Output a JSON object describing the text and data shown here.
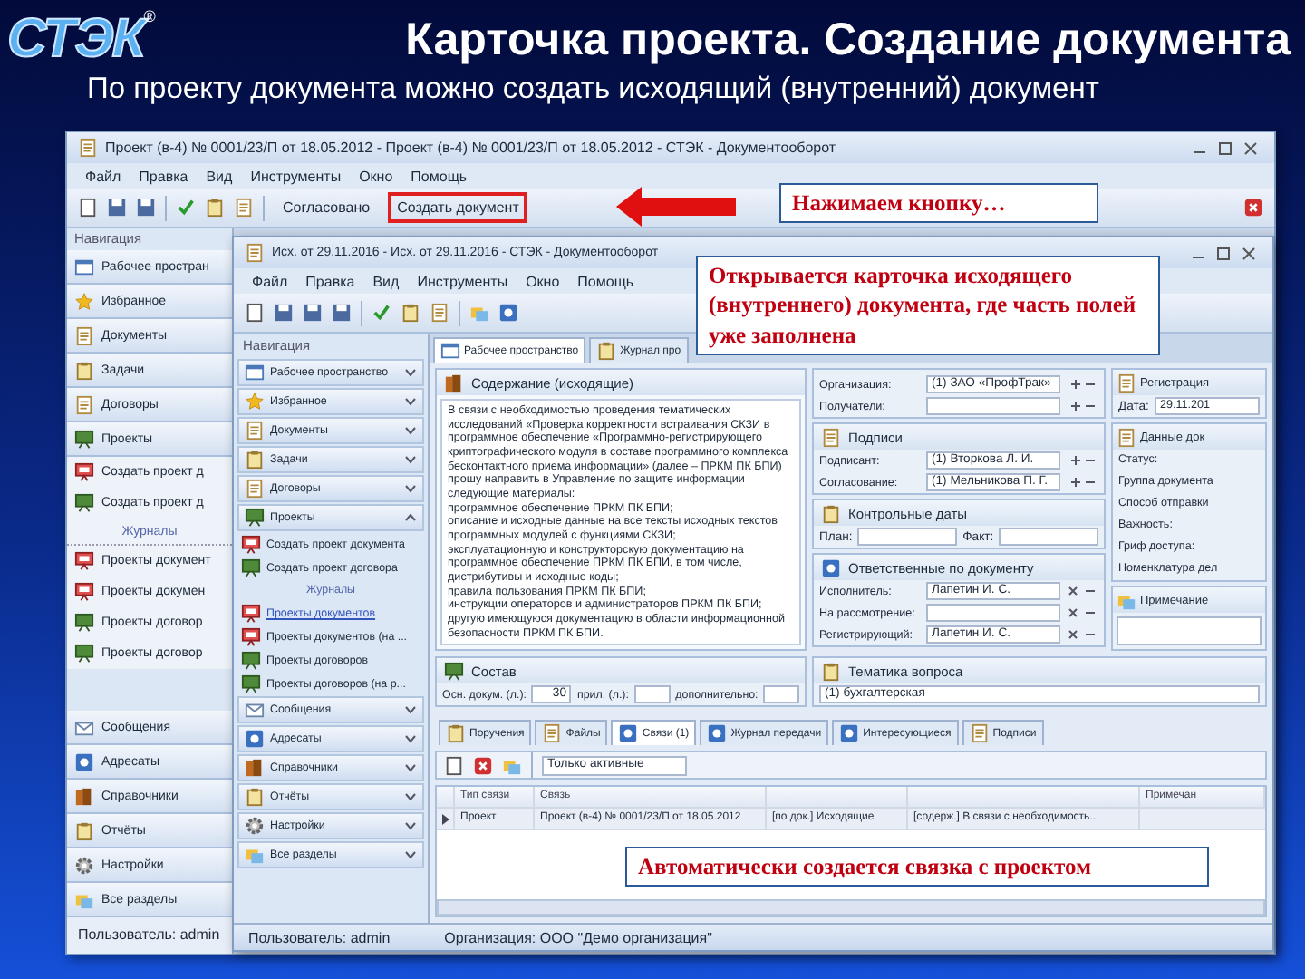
{
  "slide": {
    "logo": "СТЭК",
    "logo_mark": "®",
    "title": "Карточка проекта. Создание документа",
    "subtitle": "По проекту документа можно создать исходящий (внутренний) документ"
  },
  "back_window": {
    "title": "Проект (в-4) № 0001/23/П от 18.05.2012 - Проект (в-4) № 0001/23/П от 18.05.2012 - СТЭК - Документооборот",
    "menu": [
      "Файл",
      "Правка",
      "Вид",
      "Инструменты",
      "Окно",
      "Помощь"
    ],
    "toolbar": [
      {
        "label": "Согласовано",
        "highlighted": false
      },
      {
        "label": "Создать документ",
        "highlighted": true
      }
    ],
    "nav_header": "Навигация",
    "sections_top": [
      "Рабочее простран",
      "Избранное",
      "Документы",
      "Задачи",
      "Договоры",
      "Проекты"
    ],
    "project_items": [
      "Создать проект д",
      "Создать проект д"
    ],
    "journals_label": "Журналы",
    "journal_items": [
      "Проекты документ",
      "Проекты докумен",
      "Проекты договор",
      "Проекты договор"
    ],
    "sections_bottom": [
      "Сообщения",
      "Адресаты",
      "Справочники",
      "Отчёты",
      "Настройки",
      "Все разделы"
    ],
    "status": "Пользователь: admin"
  },
  "front_window": {
    "title": "Исх. от 29.11.2016 - Исх. от 29.11.2016 - СТЭК - Документооборот",
    "menu": [
      "Файл",
      "Правка",
      "Вид",
      "Инструменты",
      "Окно",
      "Помощь"
    ],
    "nav_header": "Навигация",
    "nav_sections": [
      {
        "label": "Рабочее пространство",
        "expanded": false
      },
      {
        "label": "Избранное",
        "expanded": false
      },
      {
        "label": "Документы",
        "expanded": false
      },
      {
        "label": "Задачи",
        "expanded": false
      },
      {
        "label": "Договоры",
        "expanded": false
      },
      {
        "label": "Проекты",
        "expanded": true,
        "items": [
          "Создать проект документа",
          "Создать проект договора"
        ],
        "journals_label": "Журналы",
        "journals": [
          {
            "label": "Проекты документов",
            "selected": true
          },
          {
            "label": "Проекты документов (на ...",
            "selected": false
          },
          {
            "label": "Проекты договоров",
            "selected": false
          },
          {
            "label": "Проекты договоров (на р...",
            "selected": false
          }
        ]
      },
      {
        "label": "Сообщения",
        "expanded": false
      },
      {
        "label": "Адресаты",
        "expanded": false
      },
      {
        "label": "Справочники",
        "expanded": false
      },
      {
        "label": "Отчёты",
        "expanded": false
      },
      {
        "label": "Настройки",
        "expanded": false
      },
      {
        "label": "Все разделы",
        "expanded": false
      }
    ],
    "tabs": [
      {
        "label": "Рабочее пространство",
        "selected": true
      },
      {
        "label": "Журнал про",
        "selected": false
      }
    ],
    "content_title": "Содержание (исходящие)",
    "content_text": "В связи с необходимостью проведения тематических исследований «Проверка корректности встраивания СКЗИ в программное обеспечение «Программно-регистрирующего криптографического модуля в составе программного комплекса бесконтактного приема информации» (далее – ПРКМ ПК БПИ) прошу направить в Управление по защите информации следующие материалы:\nпрограммное обеспечение ПРКМ ПК БПИ;\nописание и исходные данные на все тексты исходных текстов программных модулей с функциями СКЗИ;\nэксплуатационную и конструкторскую документацию на программное обеспечение ПРКМ ПК БПИ, в том числе, дистрибутивы и исходные коды;\nправила пользования ПРКМ ПК БПИ;\nинструкции операторов и администраторов ПРКМ ПК БПИ;\nдругую имеющуюся документацию в области информационной безопасности ПРКМ ПК БПИ.",
    "fields_top": [
      {
        "label": "Организация:",
        "value": "(1) ЗАО «ПрофТрак»"
      },
      {
        "label": "Получатели:"
      }
    ],
    "groups": [
      {
        "title": "Подписи",
        "kind": "rows",
        "fields": [
          {
            "label": "Подписант:",
            "value": "(1) Вторкова Л. И."
          },
          {
            "label": "Согласование:",
            "value": "(1) Мельникова П. Г."
          }
        ]
      },
      {
        "title": "Контрольные даты",
        "kind": "inline",
        "fields": [
          {
            "label": "План:"
          },
          {
            "label": "Факт:"
          }
        ]
      },
      {
        "title": "Ответственные по документу",
        "kind": "rows",
        "fields": [
          {
            "label": "Исполнитель:",
            "value": "Лапетин И. С."
          },
          {
            "label": "На рассмотрение:"
          },
          {
            "label": "Регистрирующий:",
            "value": "Лапетин И. С."
          }
        ]
      }
    ],
    "right_panel": {
      "registration_title": "Регистрация",
      "date_label": "Дата:",
      "date": "29.11.201",
      "props_title": "Данные док",
      "props": [
        "Статус:",
        "Группа документа",
        "Способ отправки",
        "Важность:",
        "Гриф доступа:",
        "Номенклатура дел"
      ],
      "note_title": "Примечание"
    },
    "composition": {
      "title": "Состав",
      "main_label": "Осн. докум. (л.):",
      "main_value": "30",
      "attach_label": "прил. (л.):",
      "extra_label": "дополнительно:"
    },
    "topic": {
      "title": "Тематика вопроса",
      "value": "(1) бухгалтерская"
    },
    "bottom_tabs": [
      {
        "label": "Поручения",
        "selected": false
      },
      {
        "label": "Файлы",
        "selected": false
      },
      {
        "label": "Связи (1)",
        "selected": true
      },
      {
        "label": "Журнал передачи",
        "selected": false
      },
      {
        "label": "Интересующиеся",
        "selected": false
      },
      {
        "label": "Подписи",
        "selected": false
      }
    ],
    "filter": "Только активные",
    "table": {
      "columns": [
        "Тип связи",
        "Связь",
        null,
        null,
        "Примечан"
      ],
      "rows": [
        {
          "current": true,
          "cells": [
            "Проект",
            "Проект (в-4) № 0001/23/П от 18.05.2012",
            "[по док.] Исходящие",
            "[содерж.] В связи с необходимость..."
          ]
        }
      ]
    },
    "status": [
      "Пользователь: admin",
      "Организация: ООО \"Демо организация\""
    ]
  },
  "callouts": [
    {
      "text": "Нажимаем кнопку…"
    },
    {
      "text": "Открывается карточка исходящего (внутреннего) документа, где часть полей уже заполнена"
    },
    {
      "text": "Автоматически создается связка с проектом"
    }
  ]
}
